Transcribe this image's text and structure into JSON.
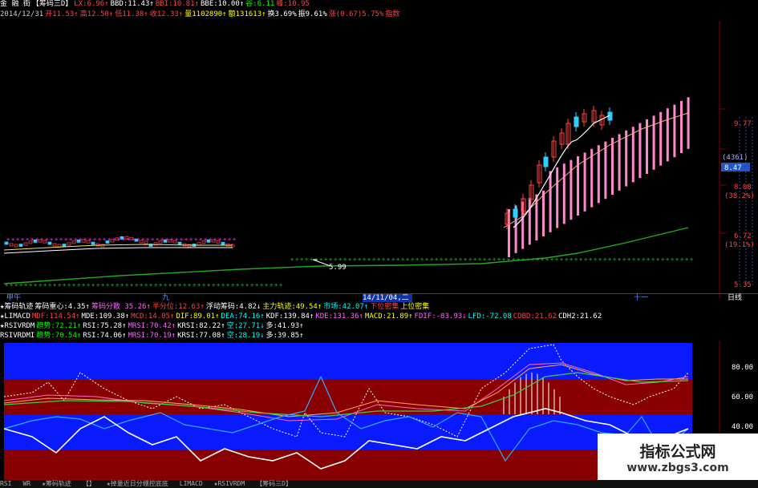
{
  "header": {
    "line1": [
      {
        "text": "金 融 街",
        "color": "#ffffff"
      },
      {
        "text": "【筹码三D】",
        "color": "#ffffff"
      },
      {
        "text": "LX:6.96↑",
        "color": "#ff4444"
      },
      {
        "text": "BBD:11.43↑",
        "color": "#ffffff"
      },
      {
        "text": "BBI:10.81↑",
        "color": "#ff4444"
      },
      {
        "text": "BBE:10.00↑",
        "color": "#ffffff"
      },
      {
        "text": "谷:6.11",
        "color": "#00ff00"
      },
      {
        "text": "峰:10.95",
        "color": "#ff4444"
      }
    ],
    "line2": [
      {
        "text": "2014/12/31",
        "color": "#cccccc"
      },
      {
        "text": "开11.53↑",
        "color": "#ff4444"
      },
      {
        "text": "高12.50↑",
        "color": "#ff4444"
      },
      {
        "text": "低11.38↑",
        "color": "#ff4444"
      },
      {
        "text": "收12.33↑",
        "color": "#ff4444"
      },
      {
        "text": "量1102890↑",
        "color": "#ffff00"
      },
      {
        "text": "额131613↑",
        "color": "#ffff00"
      },
      {
        "text": "换3.69%",
        "color": "#ffffff"
      },
      {
        "text": "振9.61%",
        "color": "#ffffff"
      },
      {
        "text": "涨(0.67)5.75%",
        "color": "#ff4444"
      },
      {
        "text": "指数",
        "color": "#ff4444"
      }
    ]
  },
  "price_axis": {
    "ticks": [
      {
        "text": "9.77",
        "color": "#ff4444"
      },
      {
        "text": "(4361)",
        "color": "#aaaaff"
      },
      {
        "text": "8.47",
        "color": "#ffffff"
      },
      {
        "text": "8.08",
        "color": "#ff4444"
      },
      {
        "text": "(38.2%)",
        "color": "#ff4444"
      },
      {
        "text": "6.72",
        "color": "#ff4444"
      },
      {
        "text": "(19.1%)",
        "color": "#ff4444"
      },
      {
        "text": "5.35",
        "color": "#ff4444"
      }
    ],
    "low_marker": "5.99"
  },
  "date_bar": {
    "left_label": "甲午",
    "month_label": "九",
    "date_label": "14/11/04,二",
    "right_label": "十一",
    "end_label": "日线"
  },
  "indicator_lines": [
    [
      {
        "text": "★筹码轨迹",
        "color": "#ffffff"
      },
      {
        "text": "筹码重心:4.35↑",
        "color": "#ffffff"
      },
      {
        "text": "筹码分散 35.26↑",
        "color": "#ff66ff"
      },
      {
        "text": "半分位:12.63↑",
        "color": "#ff4444"
      },
      {
        "text": "浮动筹码:4.82↓",
        "color": "#ffffff"
      },
      {
        "text": "主力轨迹:49.54↑",
        "color": "#ffff00"
      },
      {
        "text": "市场:42.07↑",
        "color": "#00ffff"
      },
      {
        "text": "下位密集",
        "color": "#ff4444"
      },
      {
        "text": "上位密集",
        "color": "#ffff00"
      }
    ],
    [
      {
        "text": "★LIMACD",
        "color": "#ffffff"
      },
      {
        "text": "MDF:114.54↑",
        "color": "#ff4444"
      },
      {
        "text": "MDE:109.38↑",
        "color": "#ffffff"
      },
      {
        "text": "MCD:14.05↑",
        "color": "#ff4444"
      },
      {
        "text": "DIF:89.01↑",
        "color": "#ffff00"
      },
      {
        "text": "DEA:74.16↑",
        "color": "#00ffff"
      },
      {
        "text": "KDF:139.84↑",
        "color": "#ffffff"
      },
      {
        "text": "KDE:131.36↑",
        "color": "#ff66ff"
      },
      {
        "text": "MACD:21.89↑",
        "color": "#ffff00"
      },
      {
        "text": "FDIF:-83.93↓",
        "color": "#ff66ff"
      },
      {
        "text": "LFD:-72.08",
        "color": "#00ffff"
      },
      {
        "text": "CDBD:21.62",
        "color": "#ff4444"
      },
      {
        "text": "CDH2:21.62",
        "color": "#ffffff"
      }
    ],
    [
      {
        "text": "★RSIVRDM",
        "color": "#ffffff"
      },
      {
        "text": "趋势:72.21↑",
        "color": "#00ff00"
      },
      {
        "text": "RSI:75.28↑",
        "color": "#ffffff"
      },
      {
        "text": "MRSI:70.42↑",
        "color": "#ff66ff"
      },
      {
        "text": "KRSI:82.22↑",
        "color": "#ffffff"
      },
      {
        "text": "空:27.71↓",
        "color": "#00ffff"
      },
      {
        "text": "多:41.93↑",
        "color": "#ffffff"
      }
    ],
    [
      {
        "text": "RSIVRDMI",
        "color": "#ffffff"
      },
      {
        "text": "趋势:70.54↑",
        "color": "#00ff00"
      },
      {
        "text": "RSI:74.06↑",
        "color": "#ffffff"
      },
      {
        "text": "MRSI:70.19↑",
        "color": "#ff66ff"
      },
      {
        "text": "KRSI:77.08↑",
        "color": "#ffffff"
      },
      {
        "text": "空:28.19↓",
        "color": "#00ffff"
      },
      {
        "text": "多:39.85↑",
        "color": "#ffffff"
      }
    ]
  ],
  "osc_axis": [
    "80.00",
    "60.00",
    "40.00"
  ],
  "watermark": {
    "title": "指标公式网",
    "url": "www.zbgs3.com"
  },
  "tabs": [
    "RSI",
    "WR",
    "★筹码轨迹",
    "【】",
    "★掉量近日分绷控底底",
    "LIMACD",
    "★RSIVRDM",
    "【筹码三D】"
  ],
  "colors": {
    "up": "#ff4444",
    "pink_bar": "#ff88cc",
    "ma_green": "#22aa22",
    "band_blue": "#0a1aff",
    "band_red": "#880000"
  }
}
